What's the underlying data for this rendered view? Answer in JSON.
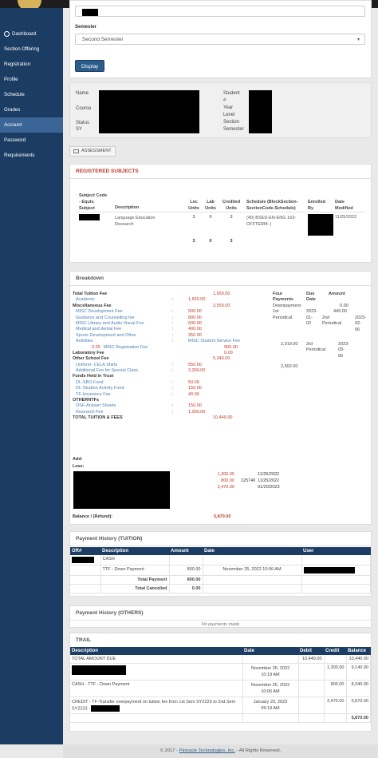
{
  "sidebar": {
    "items": [
      {
        "label": "Dashboard"
      },
      {
        "label": "Section Offering"
      },
      {
        "label": "Registration"
      },
      {
        "label": "Profile"
      },
      {
        "label": "Schedule"
      },
      {
        "label": "Grades"
      },
      {
        "label": "Account"
      },
      {
        "label": "Password"
      },
      {
        "label": "Requirements"
      }
    ]
  },
  "filter": {
    "semester_label": "Semester",
    "semester_value": "Second Semester",
    "display_button": "Display"
  },
  "student": {
    "name_label": "Name",
    "course_label": "Course",
    "status_label": "Status",
    "sy_label": "SY",
    "student_no_label_1": "Student",
    "student_no_label_2": "#",
    "year_label_1": "Year",
    "year_label_2": "Level",
    "section_label": "Section",
    "semester_label": "Semester",
    "assessment_button": "ASSESSMENT"
  },
  "registered": {
    "title": "REGISTERED SUBJECTS",
    "headers": {
      "code_1": "Subject Code",
      "code_2": "- Equiv.",
      "code_3": "Subject",
      "description": "Description",
      "lec_1": "Lec",
      "lec_2": "Units",
      "lab_1": "Lab",
      "lab_2": "Units",
      "credited_1": "Credited",
      "credited_2": "Units",
      "schedule_1": "Schedule (BlockSection-",
      "schedule_2": "SectionCode-Schedule)",
      "enrolled_1": "Enrolled",
      "enrolled_2": "By",
      "date_1": "Date",
      "date_2": "Modified"
    },
    "row": {
      "description_1": "Language Education",
      "description_2": "Research",
      "lec": "3",
      "lab": "0",
      "credited": "3",
      "schedule_1": "(49) BSED-EN-ENG 163-",
      "schedule_2": "OFFTERM- |",
      "date": "11/25/2022"
    },
    "totals": {
      "lec": "3",
      "lab": "0",
      "credited": "3"
    }
  },
  "breakdown": {
    "title": "Breakdown",
    "total_tuition_label": "Total Tuition Fee",
    "total_tuition_value": "1,650.00",
    "academic_label": "Academic",
    "academic_value": "1,650.00",
    "misc_label": "Miscellaneous Fee",
    "misc_value": "3,550.00",
    "misc_items": [
      {
        "label": "MISC Development Fee",
        "value": "500.00"
      },
      {
        "label": "Guidance and Counselling fee",
        "value": "800.00"
      },
      {
        "label": "MISC Library and Audio Visual Fee",
        "value": "600.00"
      },
      {
        "label": "Medical and dental Fee",
        "value": "400.00"
      },
      {
        "label": "Sports Development and Other",
        "value": "350.00"
      }
    ],
    "activities_label": "Activities",
    "misc_service_label": "MISC Student Service Fee",
    "misc_reg_zero": "0.00",
    "misc_reg_label": "MISC Registration Fee",
    "misc_service_value": "900.00",
    "lab_label": "Laboratory Fee",
    "lab_value": "0.00",
    "other_label": "Other School Fee",
    "other_value": "5,240.00",
    "other_items": [
      {
        "label": "Uniform- CELA Shirts",
        "value": "550.00"
      },
      {
        "label": "Additional Fee for Special Class",
        "value": "3,300.00"
      }
    ],
    "trust_label": "Funds Held in Trust",
    "trust_items": [
      {
        "label": "DL-SBO Fund",
        "value": "50.00"
      },
      {
        "label": "DL-Student Activity Fund",
        "value": "150.00"
      },
      {
        "label": "TF-Insurance Fee",
        "value": "40.00"
      }
    ],
    "otherntf_label": "OTHERNTFs",
    "otherntf_items": [
      {
        "label": "OSF-Answer Sheets",
        "value": "150.00"
      },
      {
        "label": "Research Fee",
        "value": "1,000.00"
      }
    ],
    "total_label": "TOTAL TUITION & FEES",
    "total_value": "10,440.00",
    "add_label": "Add:",
    "less_label": "Less:",
    "less_items": [
      {
        "amount": "1,300.00",
        "ref": "",
        "date": "11/25/2022"
      },
      {
        "amount": "800.00",
        "ref": "125740",
        "date": "11/25/2022"
      },
      {
        "amount": "2,470.00",
        "ref": "",
        "date": "01/20/2023"
      }
    ],
    "balance_label": "Balance / (Refund):",
    "balance_value": "5,870.00",
    "payments": {
      "col1_1": "Four",
      "col1_2": "Payments",
      "col2_1": "Due",
      "col2_2": "Date",
      "col3": "Amount",
      "downpayment_label": "Downpayment",
      "downpayment_value": "0.00",
      "p1_label": "1st",
      "p1_amount": "449.00",
      "p1_date_1": "2023-",
      "p1_date_2": "01-",
      "p1_date_3": "02",
      "periodical": "Periodical",
      "p2_label": "2nd",
      "p2_date_1": "2023-",
      "p2_date_2": "02-",
      "p2_date_3": "06",
      "p2_amount": "2,919.00",
      "p3_label": "3rd",
      "p3_date_1": "2023-",
      "p3_date_2": "03-",
      "p3_date_3": "06",
      "p4_amount": "2,502.00"
    }
  },
  "payment_history": {
    "title": "Payment History (TUITION)",
    "headers": {
      "or": "OR#",
      "description": "Description",
      "amount": "Amount",
      "date": "Date",
      "user": "User"
    },
    "cash_label": "CASH",
    "row": {
      "description": "TTF - Down Payment",
      "amount": "800.00",
      "date": "November 25, 2022 10:06 AM"
    },
    "total_payment_label": "Total Payment",
    "total_payment_value": "800.00",
    "total_cancelled_label": "Total Cancelled",
    "total_cancelled_value": "0.00"
  },
  "payment_others": {
    "title": "Payment History (OTHERS)",
    "empty": "No payments made"
  },
  "trail": {
    "title": "TRAIL",
    "headers": {
      "description": "Description",
      "date": "Date",
      "debit": "Debit",
      "credit": "Credit",
      "balance": "Balance"
    },
    "rows": [
      {
        "description": "TOTAL AMOUNT DUE",
        "date_1": "",
        "date_2": "",
        "debit": "10,440.00",
        "credit": "",
        "balance": "10,440.00"
      },
      {
        "description": "",
        "date_1": "November 25, 2022",
        "date_2": "10:19 AM",
        "debit": "",
        "credit": "1,300.00",
        "balance": "9,140.00"
      },
      {
        "description": "CASH - TTF - Down Payment",
        "date_1": "November 25, 2022",
        "date_2": "10:06 AM",
        "debit": "",
        "credit": "800.00",
        "balance": "8,340.00"
      },
      {
        "description": "CREDIT - TF-Transfer overpayment on tuition fee from 1st Sem SY2223 to 2nd Sem SY2223 -",
        "date_1": "January 20, 2023",
        "date_2": "09:19 AM",
        "debit": "",
        "credit": "2,470.00",
        "balance": "5,870.00"
      }
    ],
    "final_balance": "5,870.00"
  },
  "footer": {
    "prefix": "© 2017 -",
    "company": "Pinnacle Technologies, Inc.",
    "suffix": "- All Rights Reserved."
  }
}
